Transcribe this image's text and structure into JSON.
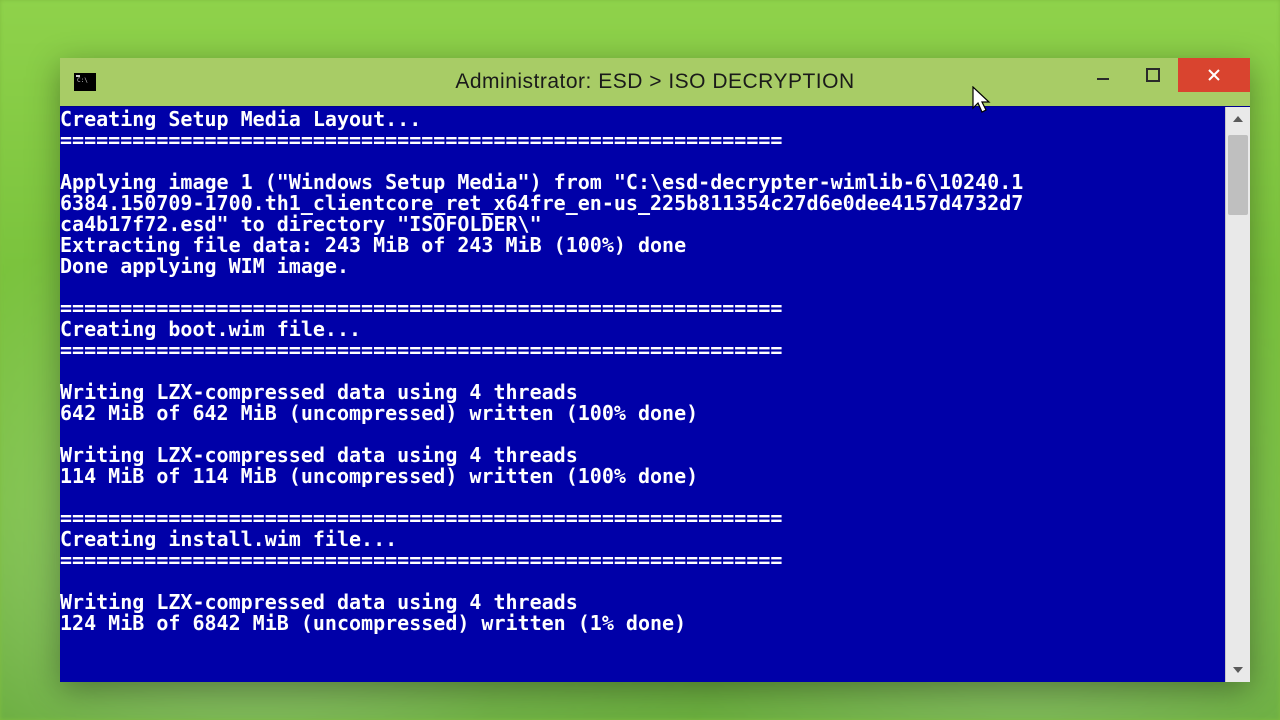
{
  "window": {
    "title": "Administrator:  ESD > ISO DECRYPTION"
  },
  "console": {
    "lines": [
      "Creating Setup Media Layout...",
      "============================================================",
      "",
      "Applying image 1 (\"Windows Setup Media\") from \"C:\\esd-decrypter-wimlib-6\\10240.1",
      "6384.150709-1700.th1_clientcore_ret_x64fre_en-us_225b811354c27d6e0dee4157d4732d7",
      "ca4b17f72.esd\" to directory \"ISOFOLDER\\\"",
      "Extracting file data: 243 MiB of 243 MiB (100%) done",
      "Done applying WIM image.",
      "",
      "============================================================",
      "Creating boot.wim file...",
      "============================================================",
      "",
      "Writing LZX-compressed data using 4 threads",
      "642 MiB of 642 MiB (uncompressed) written (100% done)",
      "",
      "Writing LZX-compressed data using 4 threads",
      "114 MiB of 114 MiB (uncompressed) written (100% done)",
      "",
      "============================================================",
      "Creating install.wim file...",
      "============================================================",
      "",
      "Writing LZX-compressed data using 4 threads",
      "124 MiB of 6842 MiB (uncompressed) written (1% done)"
    ]
  }
}
